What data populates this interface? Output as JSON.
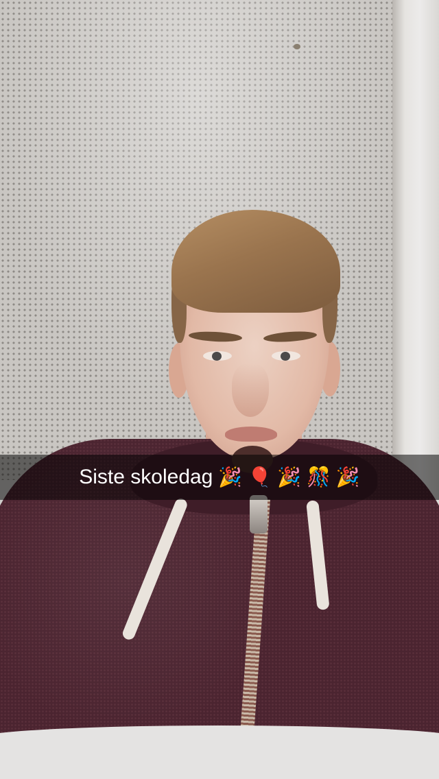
{
  "caption": {
    "text": "Siste skoledag",
    "emojis": [
      {
        "name": "party-popper",
        "glyph": "🎉"
      },
      {
        "name": "balloon",
        "glyph": "🎈"
      },
      {
        "name": "party-popper",
        "glyph": "🎉"
      },
      {
        "name": "confetti-ball",
        "glyph": "🎊"
      },
      {
        "name": "party-popper",
        "glyph": "🎉"
      }
    ]
  },
  "colors": {
    "caption_bar": "#000000",
    "caption_text": "#ffffff",
    "hoodie": "#4b2430",
    "wall": "#c9c6c2"
  }
}
